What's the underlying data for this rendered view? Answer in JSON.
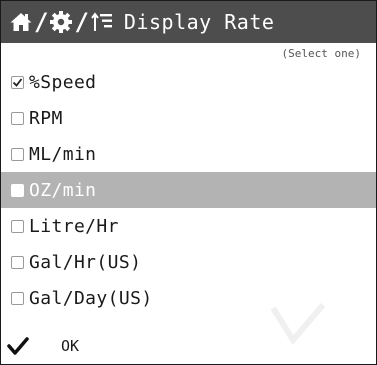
{
  "header": {
    "title": "Display Rate",
    "icons": [
      "home-icon",
      "gear-icon",
      "sort-icon"
    ],
    "separator": "/",
    "background": "#4d4d4d"
  },
  "subtitle": "(Select one)",
  "options": [
    {
      "label": "%Speed",
      "checked": true,
      "highlighted": false
    },
    {
      "label": "RPM",
      "checked": false,
      "highlighted": false
    },
    {
      "label": "ML/min",
      "checked": false,
      "highlighted": false
    },
    {
      "label": "OZ/min",
      "checked": false,
      "highlighted": true
    },
    {
      "label": "Litre/Hr",
      "checked": false,
      "highlighted": false
    },
    {
      "label": "Gal/Hr(US)",
      "checked": false,
      "highlighted": false
    },
    {
      "label": "Gal/Day(US)",
      "checked": false,
      "highlighted": false
    }
  ],
  "ok": {
    "label": "OK",
    "icon": "checkmark-icon"
  },
  "colors": {
    "highlight": "#b3b3b3",
    "text": "#1a1a1a"
  }
}
